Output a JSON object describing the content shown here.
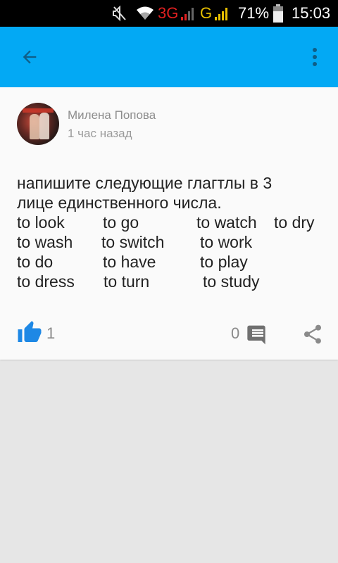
{
  "status_bar": {
    "network_3g": "3G",
    "network_g": "G",
    "battery_percent": "71%",
    "time": "15:03",
    "icons": [
      "mute-icon",
      "wifi-icon",
      "signal-icon",
      "signal-icon",
      "battery-icon"
    ]
  },
  "app_bar": {
    "back_icon": "arrow-left-icon",
    "menu_icon": "more-vert-icon",
    "color": "#03a9f4"
  },
  "post": {
    "author": "Милена Попова",
    "time": "1 час назад",
    "text_lines": [
      "напишите следующие глагтлы в 3",
      "лице единственного числа."
    ],
    "verb_rows": [
      [
        "to look",
        "to go",
        "to watch",
        "to dry"
      ],
      [
        "to wash",
        "to switch",
        "to work"
      ],
      [
        "to do",
        "to have",
        "to play"
      ],
      [
        "to dress",
        "to turn",
        "to study"
      ]
    ],
    "likes": "1",
    "comments": "0",
    "accent_color": "#1e88e5"
  }
}
